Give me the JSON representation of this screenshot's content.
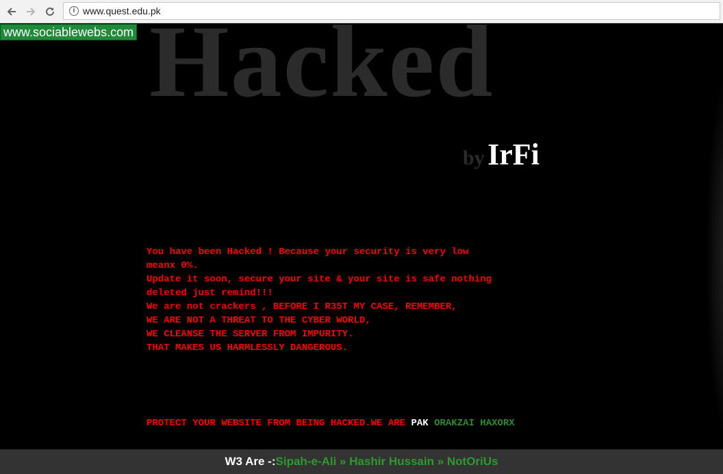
{
  "browser": {
    "url": "www.quest.edu.pk",
    "back_icon": "arrow-left-icon",
    "forward_icon": "arrow-right-icon",
    "reload_icon": "reload-icon",
    "info_icon": "info-icon"
  },
  "watermark": "www.sociablewebs.com",
  "hero": {
    "title": "Hacked",
    "by": "by",
    "author": "IrFi"
  },
  "message": {
    "lines": [
      "You have been Hacked ! Because your security is very low",
      "meanx 0%.",
      "Update it soon, secure your site & your site is safe nothing",
      "deleted just remind!!!",
      "We are not crackers , BEFORE I R35T MY CASE, REMEMBER,",
      "WE ARE NOT A THREAT TO THE CYBER WORLD,",
      "WE CLEANSE THE SERVER FROM IMPURITY.",
      "THAT MAKES US HARMLESSLY DANGEROUS."
    ]
  },
  "protect": {
    "text": "PROTECT YOUR WEBSITE FROM BEING HACKED.WE ARE",
    "pak": "PAK",
    "team": "ORAKZAI HAXORX"
  },
  "footer": {
    "prefix": "W3 Are -: ",
    "names": "Sipah-e-Ali » Hashir Hussain » NotOriUs"
  },
  "colors": {
    "message": "#ff0000",
    "green": "#2e8b2e",
    "title": "#2b2b2b",
    "watermark_bg": "#1e8a3a"
  }
}
